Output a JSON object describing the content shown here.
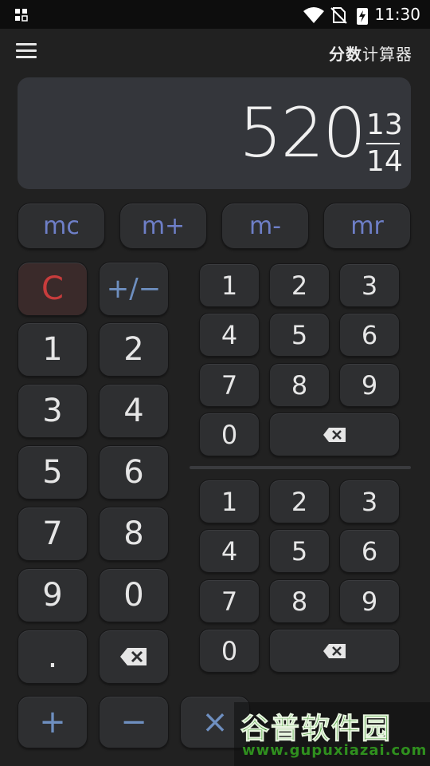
{
  "status_bar": {
    "time": "11:30"
  },
  "app_bar": {
    "title_bold": "分数",
    "title_rest": "计算器"
  },
  "display": {
    "whole": "520",
    "numerator": "13",
    "denominator": "14"
  },
  "memory_keys": [
    "mc",
    "m+",
    "m-",
    "mr"
  ],
  "left_pad": {
    "clear": "C",
    "sign": "+/−",
    "digits": [
      "1",
      "2",
      "3",
      "4",
      "5",
      "6",
      "7",
      "8",
      "9",
      "0"
    ],
    "dot": "."
  },
  "numerator_pad": {
    "digits": [
      "1",
      "2",
      "3",
      "4",
      "5",
      "6",
      "7",
      "8",
      "9",
      "0"
    ]
  },
  "denominator_pad": {
    "digits": [
      "1",
      "2",
      "3",
      "4",
      "5",
      "6",
      "7",
      "8",
      "9",
      "0"
    ]
  },
  "operators": {
    "plus": "+",
    "minus": "−",
    "times": "×"
  },
  "watermark": {
    "title": "谷普软件园",
    "url": "www.gupuxiazai.com"
  },
  "colors": {
    "background": "#212121",
    "display": "#34363b",
    "key": "#2e2f31",
    "memory_text": "#6e7fc8",
    "clear_text": "#c83c3c",
    "operator_text": "#6e8fc0"
  }
}
